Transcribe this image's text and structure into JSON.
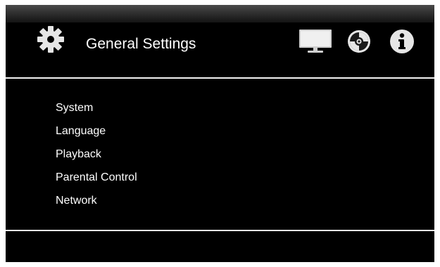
{
  "header": {
    "title": "General Settings",
    "icons": [
      "gear-icon",
      "tv-icon",
      "disc-icon",
      "info-icon"
    ]
  },
  "menu": {
    "items": [
      {
        "label": "System"
      },
      {
        "label": "Language"
      },
      {
        "label": "Playback"
      },
      {
        "label": "Parental Control"
      },
      {
        "label": "Network"
      }
    ]
  },
  "colors": {
    "background": "#000000",
    "text": "#ffffff",
    "divider": "#f2f2f2",
    "icon": "#e6e6e6"
  }
}
